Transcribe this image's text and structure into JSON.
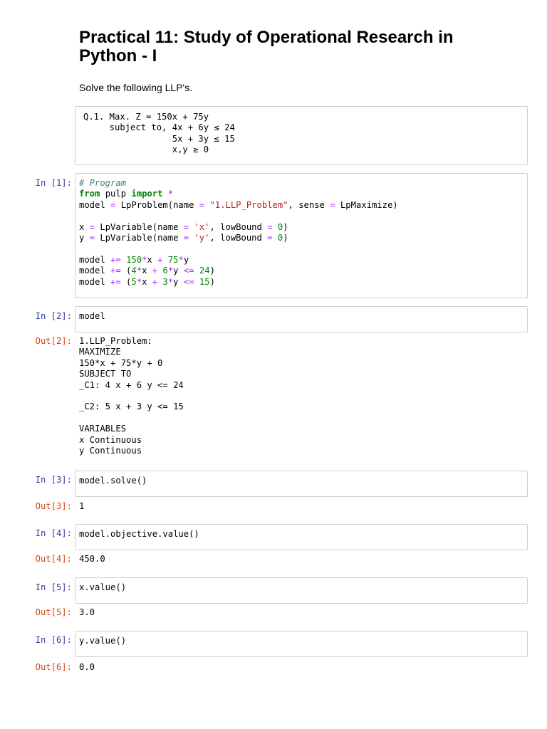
{
  "title": "Practical 11: Study of Operational Research in Python - I",
  "intro": "Solve the following LLP's.",
  "question": "Q.1. Max. Z = 150x + 75y\n     subject to, 4x + 6y ≤ 24\n                 5x + 3y ≤ 15\n                 x,y ≥ 0",
  "colors": {
    "prompt_in": "#303F9F",
    "prompt_out": "#D84315",
    "keyword": "#008000",
    "comment": "#408080",
    "string": "#BA2121",
    "number": "#008800",
    "operator": "#AA22FF"
  },
  "cells": [
    {
      "in_prompt": "In [1]:",
      "code": [
        [
          [
            "cm",
            "# Program"
          ]
        ],
        [
          [
            "kw",
            "from"
          ],
          [
            "tx",
            " pulp "
          ],
          [
            "kw",
            "import"
          ],
          [
            "tx",
            " "
          ],
          [
            "op",
            "*"
          ]
        ],
        [
          [
            "tx",
            "model "
          ],
          [
            "op",
            "="
          ],
          [
            "tx",
            " LpProblem(name "
          ],
          [
            "op",
            "="
          ],
          [
            "tx",
            " "
          ],
          [
            "st",
            "\"1.LLP_Problem\""
          ],
          [
            "tx",
            ", sense "
          ],
          [
            "op",
            "="
          ],
          [
            "tx",
            " LpMaximize)"
          ]
        ],
        [
          [
            "tx",
            ""
          ]
        ],
        [
          [
            "tx",
            "x "
          ],
          [
            "op",
            "="
          ],
          [
            "tx",
            " LpVariable(name "
          ],
          [
            "op",
            "="
          ],
          [
            "tx",
            " "
          ],
          [
            "st",
            "'x'"
          ],
          [
            "tx",
            ", lowBound "
          ],
          [
            "op",
            "="
          ],
          [
            "tx",
            " "
          ],
          [
            "nu",
            "0"
          ],
          [
            "tx",
            ")"
          ]
        ],
        [
          [
            "tx",
            "y "
          ],
          [
            "op",
            "="
          ],
          [
            "tx",
            " LpVariable(name "
          ],
          [
            "op",
            "="
          ],
          [
            "tx",
            " "
          ],
          [
            "st",
            "'y'"
          ],
          [
            "tx",
            ", lowBound "
          ],
          [
            "op",
            "="
          ],
          [
            "tx",
            " "
          ],
          [
            "nu",
            "0"
          ],
          [
            "tx",
            ")"
          ]
        ],
        [
          [
            "tx",
            ""
          ]
        ],
        [
          [
            "tx",
            "model "
          ],
          [
            "op",
            "+="
          ],
          [
            "tx",
            " "
          ],
          [
            "nu",
            "150"
          ],
          [
            "op",
            "*"
          ],
          [
            "tx",
            "x "
          ],
          [
            "op",
            "+"
          ],
          [
            "tx",
            " "
          ],
          [
            "nu",
            "75"
          ],
          [
            "op",
            "*"
          ],
          [
            "tx",
            "y"
          ]
        ],
        [
          [
            "tx",
            "model "
          ],
          [
            "op",
            "+="
          ],
          [
            "tx",
            " ("
          ],
          [
            "nu",
            "4"
          ],
          [
            "op",
            "*"
          ],
          [
            "tx",
            "x "
          ],
          [
            "op",
            "+"
          ],
          [
            "tx",
            " "
          ],
          [
            "nu",
            "6"
          ],
          [
            "op",
            "*"
          ],
          [
            "tx",
            "y "
          ],
          [
            "op",
            "<="
          ],
          [
            "tx",
            " "
          ],
          [
            "nu",
            "24"
          ],
          [
            "tx",
            ")"
          ]
        ],
        [
          [
            "tx",
            "model "
          ],
          [
            "op",
            "+="
          ],
          [
            "tx",
            " ("
          ],
          [
            "nu",
            "5"
          ],
          [
            "op",
            "*"
          ],
          [
            "tx",
            "x "
          ],
          [
            "op",
            "+"
          ],
          [
            "tx",
            " "
          ],
          [
            "nu",
            "3"
          ],
          [
            "op",
            "*"
          ],
          [
            "tx",
            "y "
          ],
          [
            "op",
            "<="
          ],
          [
            "tx",
            " "
          ],
          [
            "nu",
            "15"
          ],
          [
            "tx",
            ")"
          ]
        ]
      ]
    },
    {
      "in_prompt": "In [2]:",
      "code": [
        [
          [
            "tx",
            "model"
          ]
        ]
      ],
      "out_prompt": "Out[2]:",
      "output": "1.LLP_Problem:\nMAXIMIZE\n150*x + 75*y + 0\nSUBJECT TO\n_C1: 4 x + 6 y <= 24\n\n_C2: 5 x + 3 y <= 15\n\nVARIABLES\nx Continuous\ny Continuous"
    },
    {
      "in_prompt": "In [3]:",
      "code": [
        [
          [
            "tx",
            "model.solve()"
          ]
        ]
      ],
      "out_prompt": "Out[3]:",
      "output": "1"
    },
    {
      "in_prompt": "In [4]:",
      "code": [
        [
          [
            "tx",
            "model.objective.value()"
          ]
        ]
      ],
      "out_prompt": "Out[4]:",
      "output": "450.0"
    },
    {
      "in_prompt": "In [5]:",
      "code": [
        [
          [
            "tx",
            "x.value()"
          ]
        ]
      ],
      "out_prompt": "Out[5]:",
      "output": "3.0"
    },
    {
      "in_prompt": "In [6]:",
      "code": [
        [
          [
            "tx",
            "y.value()"
          ]
        ]
      ],
      "out_prompt": "Out[6]:",
      "output": "0.0"
    }
  ]
}
